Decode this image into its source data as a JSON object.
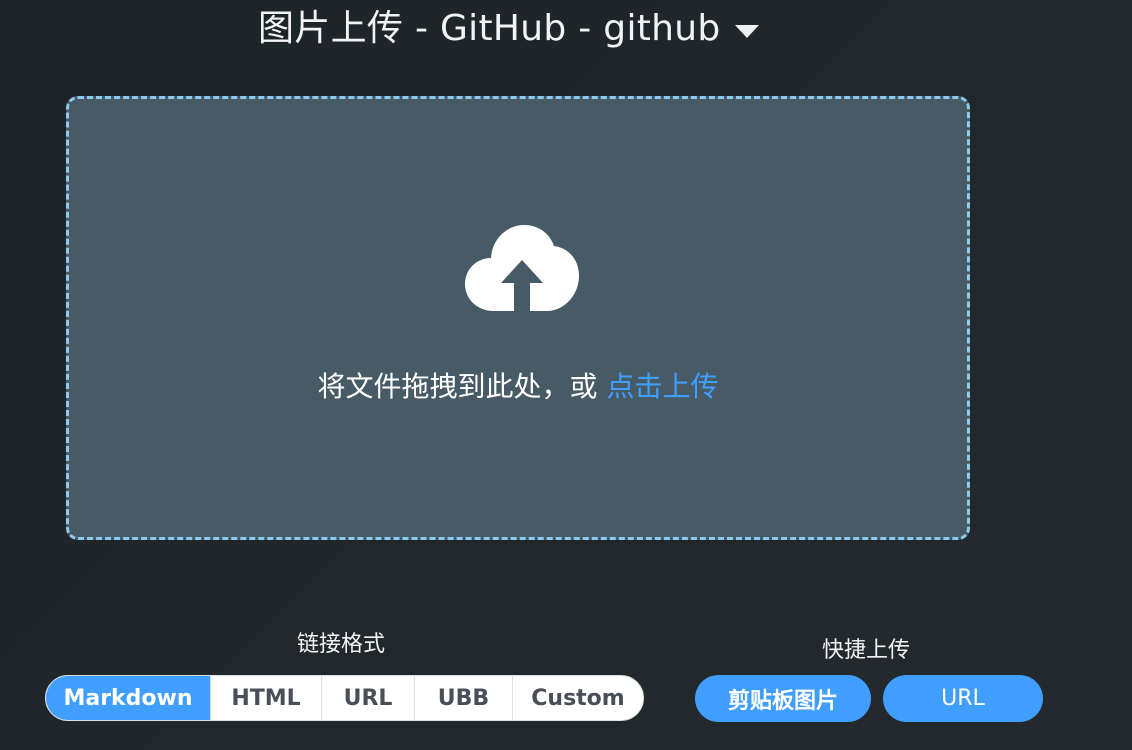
{
  "header": {
    "title": "图片上传 - GitHub - github"
  },
  "dropzone": {
    "text": "将文件拖拽到此处，或 ",
    "link": "点击上传"
  },
  "link_format": {
    "label": "链接格式",
    "options": [
      "Markdown",
      "HTML",
      "URL",
      "UBB",
      "Custom"
    ],
    "selected": "Markdown"
  },
  "quick_upload": {
    "label": "快捷上传",
    "clipboard_button": "剪贴板图片",
    "url_button": "URL"
  },
  "colors": {
    "accent": "#409eff",
    "dropzone_bg": "#475b66",
    "dropzone_border": "#8ec9ef",
    "page_bg": "#1f262a"
  }
}
